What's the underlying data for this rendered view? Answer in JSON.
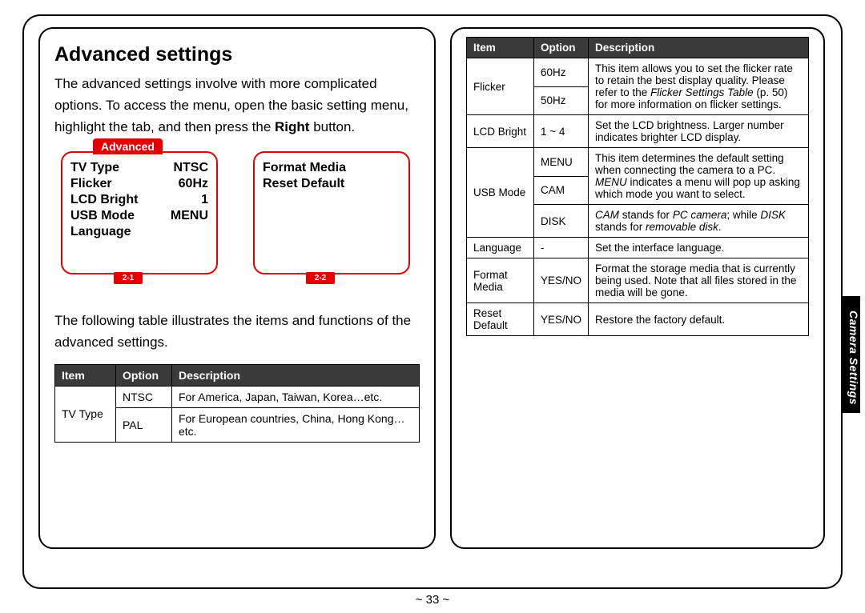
{
  "left": {
    "title": "Advanced settings",
    "para1_pre": "The advanced settings involve with more complicated options. To access the menu, open the basic setting menu, highlight the tab, and then press the ",
    "para1_bold": "Right",
    "para1_post": " button.",
    "tab_label": "Advanced",
    "screen1": {
      "rows": [
        {
          "label": "TV Type",
          "value": "NTSC"
        },
        {
          "label": "Flicker",
          "value": "60Hz"
        },
        {
          "label": "LCD Bright",
          "value": "1"
        },
        {
          "label": "USB Mode",
          "value": "MENU"
        },
        {
          "label": "Language",
          "value": ""
        }
      ],
      "tag": "2-1"
    },
    "screen2": {
      "rows": [
        {
          "label": "Format Media",
          "value": ""
        },
        {
          "label": "Reset Default",
          "value": ""
        }
      ],
      "tag": "2-2"
    },
    "para2": "The following table illustrates the items and functions of the advanced settings.",
    "table_headers": {
      "item": "Item",
      "option": "Option",
      "desc": "Description"
    },
    "table_rows": [
      {
        "item": "TV Type",
        "option": "NTSC",
        "desc": "For America, Japan, Taiwan, Korea…etc."
      },
      {
        "item": "",
        "option": "PAL",
        "desc": "For European countries, China, Hong Kong…etc."
      }
    ]
  },
  "right": {
    "headers": {
      "item": "Item",
      "option": "Option",
      "desc": "Description"
    },
    "rows": [
      {
        "item": "Flicker",
        "options": [
          "60Hz",
          "50Hz"
        ],
        "desc_parts": [
          {
            "t": "This item allows you to set the flicker rate to retain the best display quality. Please refer to the "
          },
          {
            "i": "Flicker Settings Table"
          },
          {
            "t": " (p. 50) for more information on flicker settings."
          }
        ]
      },
      {
        "item": "LCD Bright",
        "options": [
          "1 ~ 4"
        ],
        "desc": "Set the LCD brightness. Larger number indicates brighter LCD display."
      },
      {
        "item": "USB Mode",
        "options": [
          "MENU",
          "CAM",
          "DISK"
        ],
        "desc_parts_top": [
          {
            "t": "This item determines the default setting when connecting the camera to a PC. "
          },
          {
            "i": "MENU"
          },
          {
            "t": " indicates a menu will pop up asking which mode you want to select."
          }
        ],
        "desc_parts_bottom": [
          {
            "i": "CAM"
          },
          {
            "t": " stands for "
          },
          {
            "i": "PC camera"
          },
          {
            "t": "; while "
          },
          {
            "i": "DISK"
          },
          {
            "t": " stands for "
          },
          {
            "i": "removable disk"
          },
          {
            "t": "."
          }
        ]
      },
      {
        "item": "Language",
        "options": [
          "-"
        ],
        "desc": "Set the interface language."
      },
      {
        "item": "Format Media",
        "options": [
          "YES/NO"
        ],
        "desc": "Format the storage media that is currently being used. Note that all files stored in the media will be gone."
      },
      {
        "item": "Reset Default",
        "options": [
          "YES/NO"
        ],
        "desc": "Restore the factory default."
      }
    ]
  },
  "side_tab": "Camera Settings",
  "page_number": "~ 33 ~"
}
